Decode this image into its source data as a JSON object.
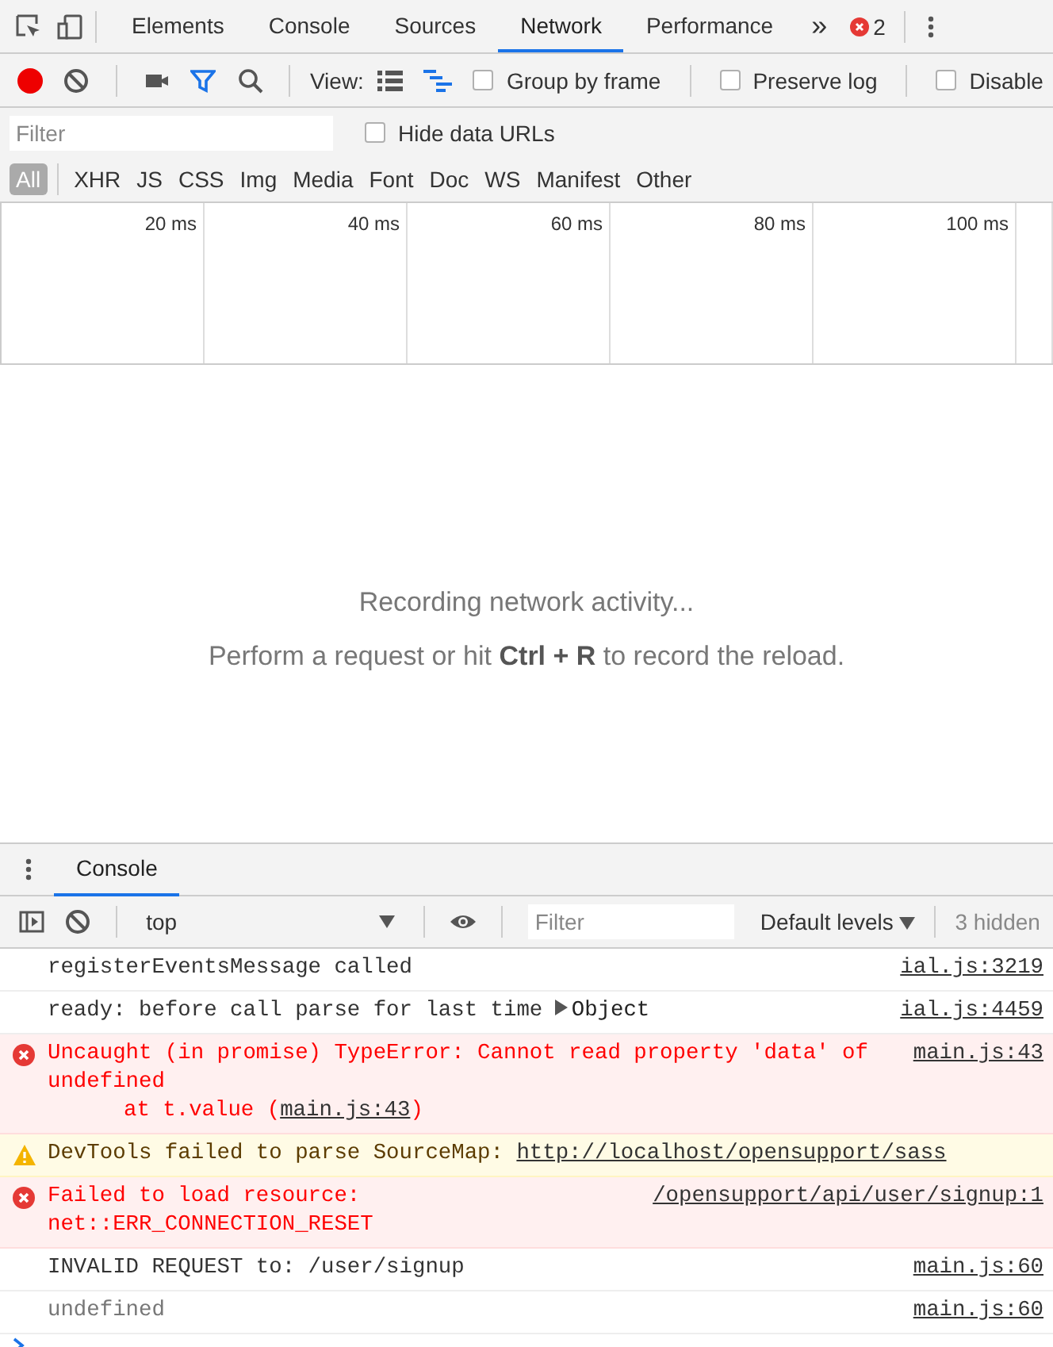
{
  "main_tabs": [
    {
      "label": "Elements",
      "selected": false
    },
    {
      "label": "Console",
      "selected": false
    },
    {
      "label": "Sources",
      "selected": false
    },
    {
      "label": "Network",
      "selected": true
    },
    {
      "label": "Performance",
      "selected": false
    }
  ],
  "overflow": "»",
  "error_count": "2",
  "toolbar": {
    "recording": true,
    "filter_active": true,
    "view_label": "View:",
    "view_buttons": [
      {
        "kind": "list",
        "selected": false
      },
      {
        "kind": "waterfall",
        "selected": true
      }
    ],
    "checkboxes": [
      {
        "label": "Group by frame",
        "checked": false
      },
      {
        "label": "Preserve log",
        "checked": false
      },
      {
        "label": "Disable",
        "checked": false
      }
    ]
  },
  "filter": {
    "placeholder": "Filter",
    "hide_data_urls": {
      "label": "Hide data URLs",
      "checked": false
    }
  },
  "type_filters": [
    {
      "label": "All",
      "selected": true
    },
    {
      "label": "XHR",
      "selected": false
    },
    {
      "label": "JS",
      "selected": false
    },
    {
      "label": "CSS",
      "selected": false
    },
    {
      "label": "Img",
      "selected": false
    },
    {
      "label": "Media",
      "selected": false
    },
    {
      "label": "Font",
      "selected": false
    },
    {
      "label": "Doc",
      "selected": false
    },
    {
      "label": "WS",
      "selected": false
    },
    {
      "label": "Manifest",
      "selected": false
    },
    {
      "label": "Other",
      "selected": false
    }
  ],
  "timeline_ticks": [
    "20 ms",
    "40 ms",
    "60 ms",
    "80 ms",
    "100 ms"
  ],
  "empty_state": {
    "title": "Recording network activity...",
    "hint": "Perform a request or hit **Ctrl + R** to record the reload."
  },
  "drawer_tabs": [
    {
      "label": "Console",
      "selected": true
    }
  ],
  "console_toolbar": {
    "context": "top",
    "filter_placeholder": "Filter",
    "levels": "Default levels",
    "hidden": "3 hidden"
  },
  "messages": [
    {
      "kind": "log",
      "text": "registerEventsMessage called",
      "source": "ial.js:3219"
    },
    {
      "kind": "log",
      "text": "ready: before call parse for last time",
      "object": {
        "label": "Object",
        "expanded": false
      },
      "source": "ial.js:4459"
    },
    {
      "kind": "error",
      "text": "Uncaught (in promise) TypeError: Cannot read property 'data' of undefined",
      "trace": {
        "prefix": "at t.value (",
        "link": "main.js:43",
        "suffix": ")"
      },
      "source": "main.js:43"
    },
    {
      "kind": "warning",
      "text": "DevTools failed to parse SourceMap: ",
      "link": "http://localhost/opensupport/sass"
    },
    {
      "kind": "error",
      "text": "Failed to load resource: net::ERR_CONNECTION_RESET",
      "source": "/opensupport/api/user/signup:1"
    },
    {
      "kind": "log",
      "text": "INVALID REQUEST to: /user/signup",
      "source": "main.js:60"
    },
    {
      "kind": "result",
      "text": "undefined",
      "source": "main.js:60"
    }
  ]
}
